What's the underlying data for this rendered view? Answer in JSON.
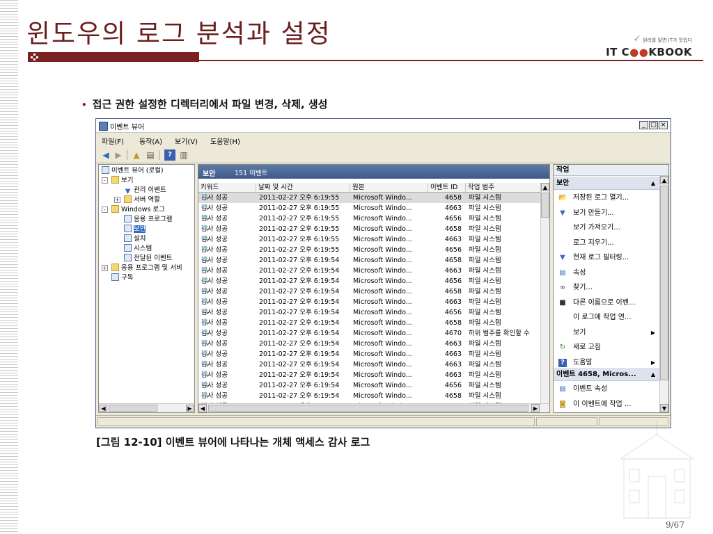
{
  "slide": {
    "title": "윈도우의 로그 분석과 설정",
    "brand_tagline": "원리를 알면 IT가 맛있다",
    "brand_logo_left": "IT C",
    "brand_logo_oo": "●●",
    "brand_logo_right": "KBOOK",
    "bullet": "접근 권한 설정한 디렉터리에서 파일 변경, 삭제, 생성",
    "caption": "[그림 12-10] 이벤트 뷰어에 나타나는 개체 액세스 감사 로그",
    "page": "9/67"
  },
  "window": {
    "title": "이벤트 뷰어",
    "buttons": [
      "_",
      "□",
      "×"
    ],
    "menu": [
      "파일(F)",
      "동작(A)",
      "보기(V)",
      "도움말(H)"
    ]
  },
  "tree": {
    "items": [
      {
        "label": "이벤트 뷰어 (로컬)",
        "icon": "event-viewer-icon",
        "indent": 0
      },
      {
        "label": "보기",
        "icon": "folder-icon",
        "indent": 1,
        "expander": "-"
      },
      {
        "label": "관리 이벤트",
        "icon": "filter-icon",
        "indent": 2
      },
      {
        "label": "서버 역할",
        "icon": "folder-icon",
        "indent": 2,
        "expander": "+"
      },
      {
        "label": "Windows 로그",
        "icon": "folder-icon",
        "indent": 1,
        "expander": "-"
      },
      {
        "label": "응용 프로그램",
        "icon": "log-icon",
        "indent": 2
      },
      {
        "label": "보안",
        "icon": "log-icon",
        "indent": 2,
        "selected": true
      },
      {
        "label": "설치",
        "icon": "log-icon",
        "indent": 2
      },
      {
        "label": "시스템",
        "icon": "log-icon",
        "indent": 2
      },
      {
        "label": "전달된 이벤트",
        "icon": "log-icon",
        "indent": 2
      },
      {
        "label": "응용 프로그램 및 서비",
        "icon": "folder-icon",
        "indent": 1,
        "expander": "+"
      },
      {
        "label": "구독",
        "icon": "log-icon",
        "indent": 1
      }
    ]
  },
  "center": {
    "header_title": "보안",
    "header_count": "151 이벤트",
    "columns": [
      "키워드",
      "날짜 및 시간",
      "원본",
      "이벤트 ID",
      "작업 범주"
    ],
    "rows": [
      [
        "감사 성공",
        "2011-02-27 오후 6:19:55",
        "Microsoft Windo...",
        "4658",
        "파일 시스템"
      ],
      [
        "감사 성공",
        "2011-02-27 오후 6:19:55",
        "Microsoft Windo...",
        "4663",
        "파일 시스템"
      ],
      [
        "감사 성공",
        "2011-02-27 오후 6:19:55",
        "Microsoft Windo...",
        "4656",
        "파일 시스템"
      ],
      [
        "감사 성공",
        "2011-02-27 오후 6:19:55",
        "Microsoft Windo...",
        "4658",
        "파일 시스템"
      ],
      [
        "감사 성공",
        "2011-02-27 오후 6:19:55",
        "Microsoft Windo...",
        "4663",
        "파일 시스템"
      ],
      [
        "감사 성공",
        "2011-02-27 오후 6:19:55",
        "Microsoft Windo...",
        "4656",
        "파일 시스템"
      ],
      [
        "감사 성공",
        "2011-02-27 오후 6:19:54",
        "Microsoft Windo...",
        "4658",
        "파일 시스템"
      ],
      [
        "감사 성공",
        "2011-02-27 오후 6:19:54",
        "Microsoft Windo...",
        "4663",
        "파일 시스템"
      ],
      [
        "감사 성공",
        "2011-02-27 오후 6:19:54",
        "Microsoft Windo...",
        "4656",
        "파일 시스템"
      ],
      [
        "감사 성공",
        "2011-02-27 오후 6:19:54",
        "Microsoft Windo...",
        "4658",
        "파일 시스템"
      ],
      [
        "감사 성공",
        "2011-02-27 오후 6:19:54",
        "Microsoft Windo...",
        "4663",
        "파일 시스템"
      ],
      [
        "감사 성공",
        "2011-02-27 오후 6:19:54",
        "Microsoft Windo...",
        "4656",
        "파일 시스템"
      ],
      [
        "감사 성공",
        "2011-02-27 오후 6:19:54",
        "Microsoft Windo...",
        "4658",
        "파일 시스템"
      ],
      [
        "감사 성공",
        "2011-02-27 오후 6:19:54",
        "Microsoft Windo...",
        "4670",
        "하위 범주를 확인할 수"
      ],
      [
        "감사 성공",
        "2011-02-27 오후 6:19:54",
        "Microsoft Windo...",
        "4663",
        "파일 시스템"
      ],
      [
        "감사 성공",
        "2011-02-27 오후 6:19:54",
        "Microsoft Windo...",
        "4663",
        "파일 시스템"
      ],
      [
        "감사 성공",
        "2011-02-27 오후 6:19:54",
        "Microsoft Windo...",
        "4663",
        "파일 시스템"
      ],
      [
        "감사 성공",
        "2011-02-27 오후 6:19:54",
        "Microsoft Windo...",
        "4663",
        "파일 시스템"
      ],
      [
        "감사 성공",
        "2011-02-27 오후 6:19:54",
        "Microsoft Windo...",
        "4656",
        "파일 시스템"
      ],
      [
        "감사 성공",
        "2011-02-27 오후 6:19:54",
        "Microsoft Windo...",
        "4658",
        "파일 시스템"
      ],
      [
        "감사 성공",
        "2011-02-27 오후 6:19:54",
        "Microsoft Windo...",
        "4663",
        "파일 시스템"
      ]
    ]
  },
  "actions": {
    "title": "작업",
    "section1": "보안",
    "items1": [
      {
        "label": "저장된 로그 열기...",
        "icon": "open-folder-icon"
      },
      {
        "label": "보기 만들기...",
        "icon": "filter-icon"
      },
      {
        "label": "보기 가져오기...",
        "icon": ""
      },
      {
        "label": "로그 지우기...",
        "icon": ""
      },
      {
        "label": "현재 로그 필터링...",
        "icon": "filter-icon"
      },
      {
        "label": "속성",
        "icon": "properties-icon"
      },
      {
        "label": "찾기...",
        "icon": "binoculars-icon"
      },
      {
        "label": "다른 이름으로 이벤...",
        "icon": "save-icon"
      },
      {
        "label": "이 로그에 작업 연...",
        "icon": ""
      },
      {
        "label": "보기",
        "icon": "",
        "submenu": true
      },
      {
        "label": "새로 고침",
        "icon": "refresh-icon"
      },
      {
        "label": "도움말",
        "icon": "help-icon",
        "submenu": true
      }
    ],
    "section2": "이벤트 4658, Micros...",
    "items2": [
      {
        "label": "이벤트 속성",
        "icon": "properties-icon"
      },
      {
        "label": "이 이벤트에 작업 ...",
        "icon": "task-icon"
      }
    ]
  }
}
